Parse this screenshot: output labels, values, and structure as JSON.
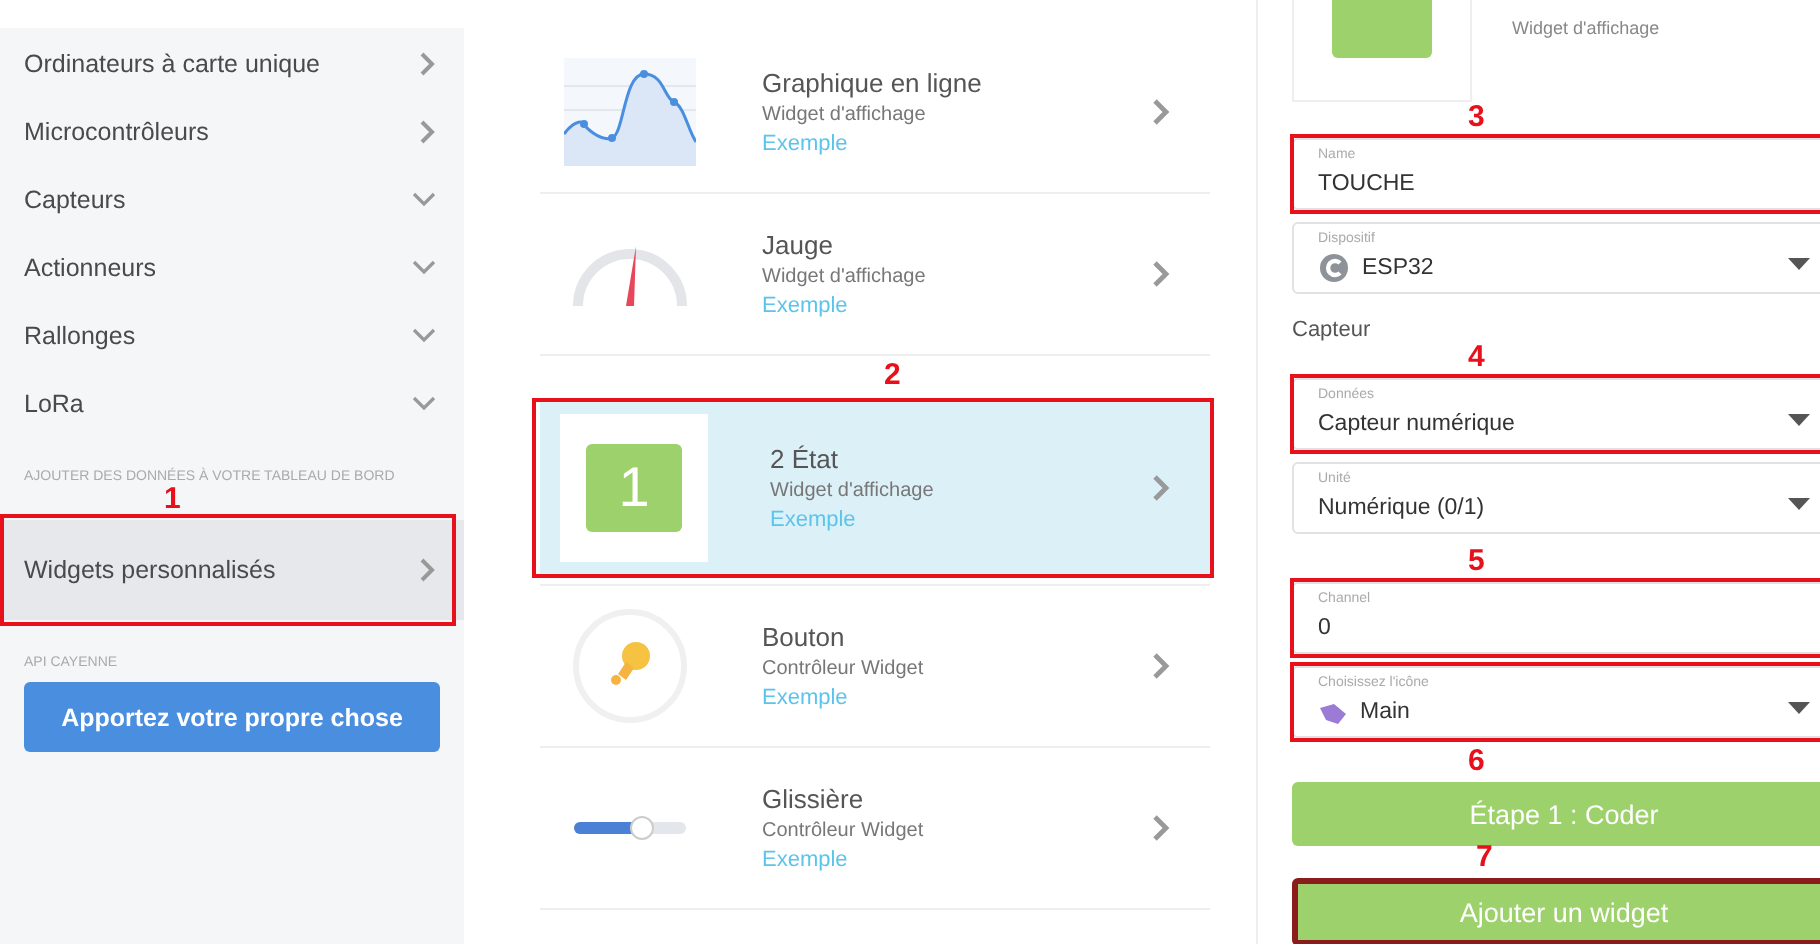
{
  "sidebar": {
    "items": [
      {
        "label": "Ordinateurs à carte unique",
        "kind": "link",
        "selected": false
      },
      {
        "label": "Microcontrôleurs",
        "kind": "link",
        "selected": false
      },
      {
        "label": "Capteurs",
        "kind": "group",
        "selected": false
      },
      {
        "label": "Actionneurs",
        "kind": "group",
        "selected": false
      },
      {
        "label": "Rallonges",
        "kind": "group",
        "selected": false
      },
      {
        "label": "LoRa",
        "kind": "group",
        "selected": false
      }
    ],
    "section_title": "AJOUTER DES DONNÉES À VOTRE TABLEAU DE BORD",
    "custom_item": {
      "label": "Widgets personnalisés",
      "selected": true,
      "marker": {
        "number": "1",
        "kind": "above"
      }
    },
    "api_title": "API CAYENNE",
    "api_button": "Apportez votre propre chose"
  },
  "widgets": [
    {
      "title": "Graphique en ligne",
      "subtitle": "Widget d'affichage",
      "link": "Exemple",
      "kind": "line-chart",
      "selected": false
    },
    {
      "title": "Jauge",
      "subtitle": "Widget d'affichage",
      "link": "Exemple",
      "kind": "gauge",
      "selected": false
    },
    {
      "title": "2 État",
      "subtitle": "Widget d'affichage",
      "link": "Exemple",
      "kind": "value-tile",
      "tile_value": "1",
      "selected": true,
      "marker": {
        "number": "2",
        "kind": "above"
      }
    },
    {
      "title": "Bouton",
      "subtitle": "Contrôleur Widget",
      "link": "Exemple",
      "kind": "bulb",
      "selected": false
    },
    {
      "title": "Glissière",
      "subtitle": "Contrôleur Widget",
      "link": "Exemple",
      "kind": "slider",
      "level": 0.6,
      "selected": false
    }
  ],
  "settings": {
    "preview_subtitle": "Widget d'affichage",
    "fields": [
      {
        "kind": "text",
        "label": "Name",
        "value": "TOUCHE",
        "marker": {
          "number": "3",
          "kind": "above"
        }
      },
      {
        "kind": "device-select",
        "label": "Dispositif",
        "value": "ESP32"
      },
      {
        "kind": "heading",
        "value": "Capteur"
      },
      {
        "kind": "select",
        "label": "Données",
        "value": "Capteur numérique",
        "marker": {
          "number": "4",
          "kind": "above"
        }
      },
      {
        "kind": "select",
        "label": "Unité",
        "value": "Numérique (0/1)"
      },
      {
        "kind": "text",
        "label": "Channel",
        "value": "0",
        "marker": {
          "number": "5",
          "kind": "above"
        }
      },
      {
        "kind": "icon-select",
        "label": "Choisissez l'icône",
        "value": "Main",
        "marker": {
          "number": "6",
          "kind": "below"
        }
      }
    ],
    "buttons": [
      {
        "label": "Étape 1 : Coder"
      },
      {
        "label": "Ajouter un widget",
        "marker": {
          "number": "7",
          "kind": "above"
        }
      }
    ]
  }
}
